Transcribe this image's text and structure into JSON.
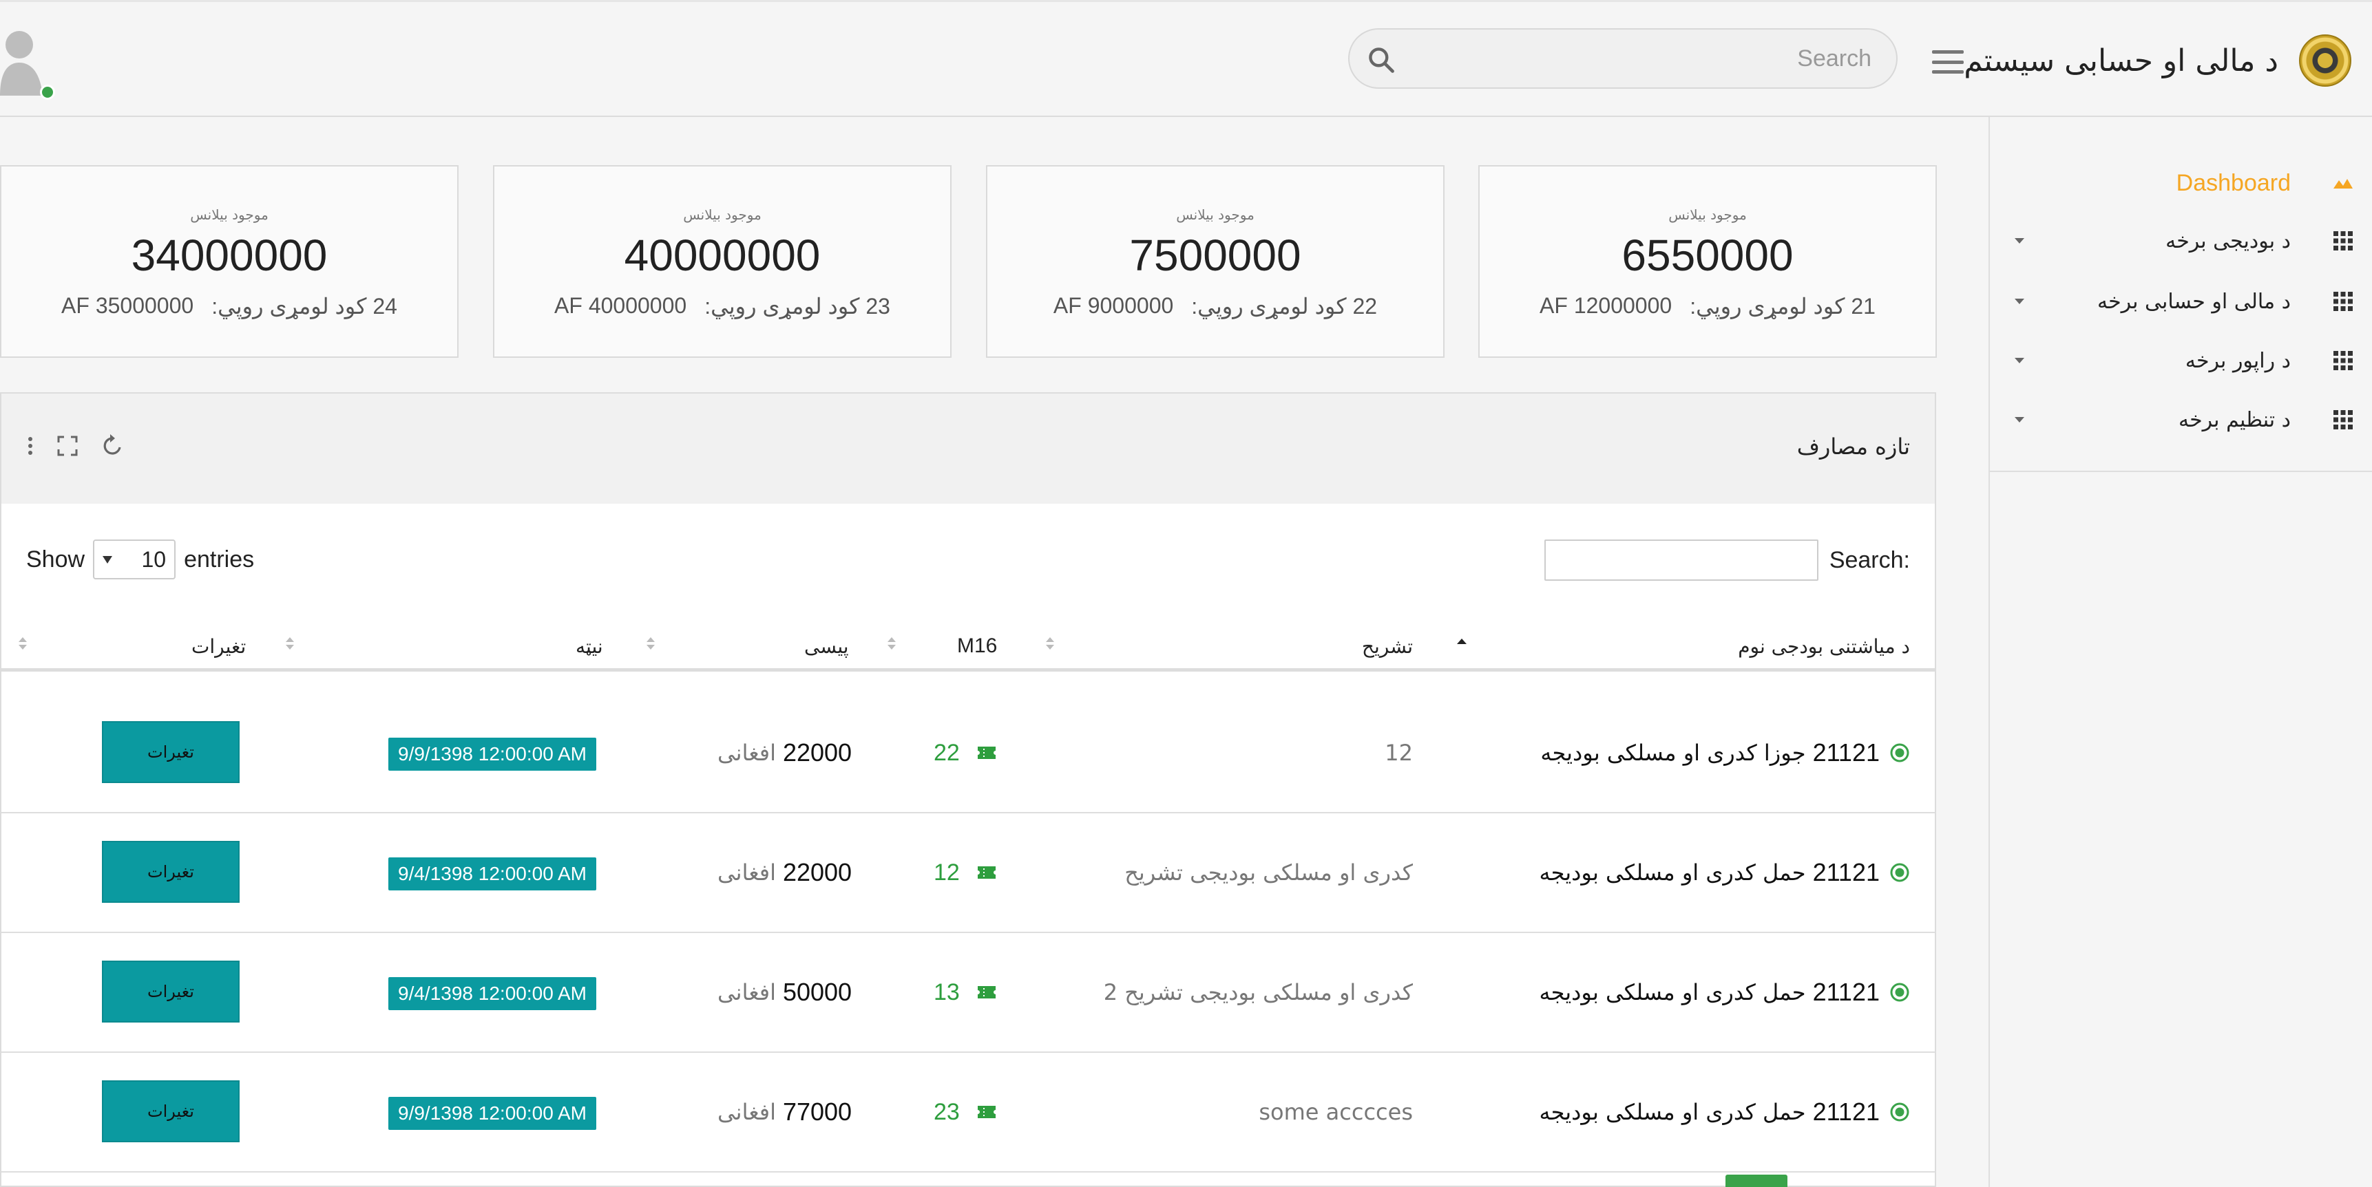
{
  "header": {
    "title": "د مالی او حسابی سیستم",
    "search_placeholder": "Search"
  },
  "sidebar": {
    "items": [
      {
        "label": "Dashboard",
        "active": true
      },
      {
        "label": "د بودیجی برخه"
      },
      {
        "label": "د مالی او حسابی برخه"
      },
      {
        "label": "د راپور برخه"
      },
      {
        "label": "د تنظیم برخه"
      }
    ]
  },
  "cards": [
    {
      "label": "موجود بیلانس",
      "value": "6550000",
      "code": "21",
      "code_label": "کود لومړی روپي:",
      "amount": "AF 12000000"
    },
    {
      "label": "موجود بیلانس",
      "value": "7500000",
      "code": "22",
      "code_label": "کود لومړی روپي:",
      "amount": "AF 9000000"
    },
    {
      "label": "موجود بیلانس",
      "value": "40000000",
      "code": "23",
      "code_label": "کود لومړی روپي:",
      "amount": "AF 40000000"
    },
    {
      "label": "موجود بیلانس",
      "value": "34000000",
      "code": "24",
      "code_label": "کود لومړی روپي:",
      "amount": "AF 35000000"
    }
  ],
  "panel": {
    "title": "تازه مصارف",
    "show_label": "Show",
    "entries_value": "10",
    "entries_label": "entries",
    "search_label": "Search:",
    "columns": [
      "د میاشتنی بودجی نوم",
      "تشریح",
      "M16",
      "پیسی",
      "نیټه",
      "تغیرات"
    ],
    "rows": [
      {
        "code": "21121",
        "name": "جوزا کدری او مسلکی بودیجه",
        "desc": "12",
        "m16": "22",
        "amount": "22000",
        "currency": "افغانی",
        "date": "9/9/1398 12:00:00 AM",
        "action": "تغیرات"
      },
      {
        "code": "21121",
        "name": "حمل کدری او مسلکی بودیجه",
        "desc": "کدری او مسلکی بودیجی تشریح",
        "m16": "12",
        "amount": "22000",
        "currency": "افغانی",
        "date": "9/4/1398 12:00:00 AM",
        "action": "تغیرات"
      },
      {
        "code": "21121",
        "name": "حمل کدری او مسلکی بودیجه",
        "desc": "کدری او مسلکی بودیجی تشریح 2",
        "m16": "13",
        "amount": "50000",
        "currency": "افغانی",
        "date": "9/4/1398 12:00:00 AM",
        "action": "تغیرات"
      },
      {
        "code": "21121",
        "name": "حمل کدری او مسلکی بودیجه",
        "desc": "some acccces",
        "m16": "23",
        "amount": "77000",
        "currency": "افغانی",
        "date": "9/9/1398 12:00:00 AM",
        "action": "تغیرات"
      }
    ]
  },
  "colors": {
    "accent": "#f5a623",
    "teal": "#0b9aa0",
    "green": "#2e9e3e"
  }
}
